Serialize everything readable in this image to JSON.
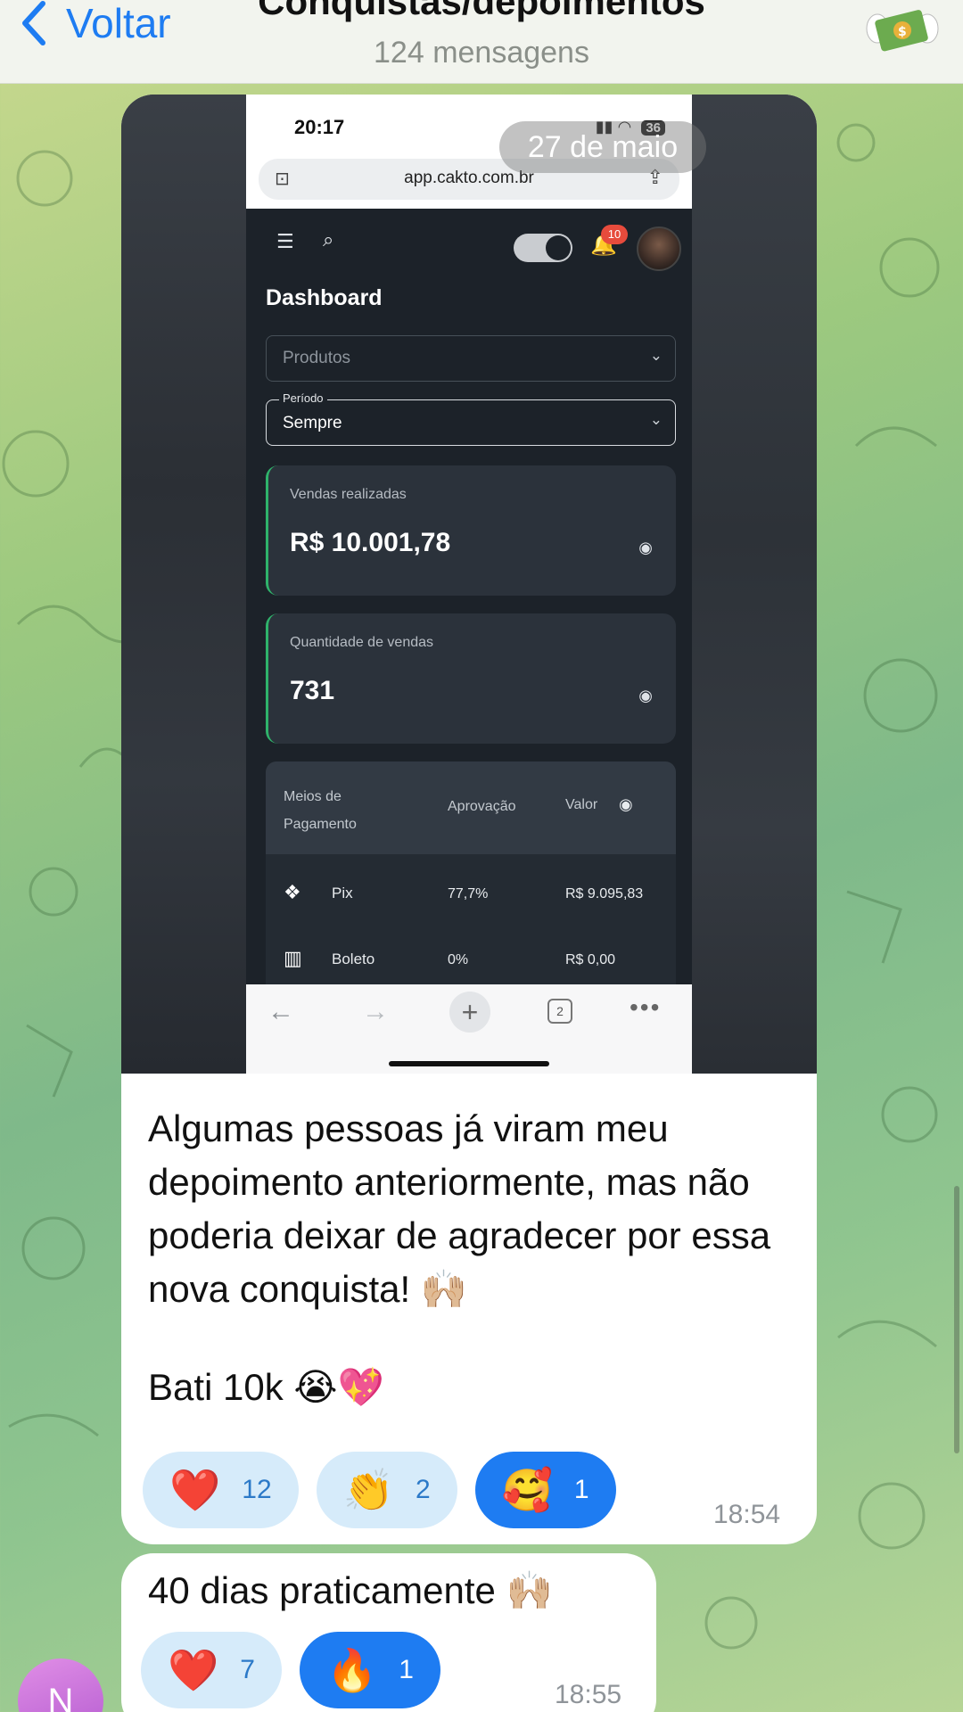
{
  "header": {
    "back_label": "Voltar",
    "title": "Conquistas/depoimentos",
    "subtitle": "124 mensagens"
  },
  "date_pill": "27 de maio",
  "screenshot": {
    "status_time": "20:17",
    "battery": "36",
    "url": "app.cakto.com.br",
    "notifications": "10",
    "page_title": "Dashboard",
    "products_select": "Produtos",
    "period_label": "Período",
    "period_value": "Sempre",
    "sales_label": "Vendas realizadas",
    "sales_value": "R$ 10.001,78",
    "qty_label": "Quantidade de vendas",
    "qty_value": "731",
    "payments_header": {
      "col1": "Meios de Pagamento",
      "col2": "Aprovação",
      "col3": "Valor"
    },
    "payments": [
      {
        "name": "Pix",
        "approval": "77,7%",
        "value": "R$ 9.095,83"
      },
      {
        "name": "Boleto",
        "approval": "0%",
        "value": "R$ 0,00"
      }
    ],
    "tab_count": "2"
  },
  "message1": {
    "lines": [
      "Algumas pessoas já viram meu depoimento anteriormente, mas não poderia deixar de agradecer por essa nova conquista! 🙌🏼",
      "Bati 10k 😭💖"
    ],
    "reactions": [
      {
        "emoji": "❤️",
        "count": "12"
      },
      {
        "emoji": "👏",
        "count": "2"
      },
      {
        "emoji": "🥰",
        "count": "1"
      }
    ],
    "time": "18:54"
  },
  "message2": {
    "text": "40 dias praticamente 🙌🏼",
    "reactions": [
      {
        "emoji": "❤️",
        "count": "7"
      },
      {
        "emoji": "🔥",
        "count": "1"
      }
    ],
    "time": "18:55"
  },
  "sender_initial": "N"
}
